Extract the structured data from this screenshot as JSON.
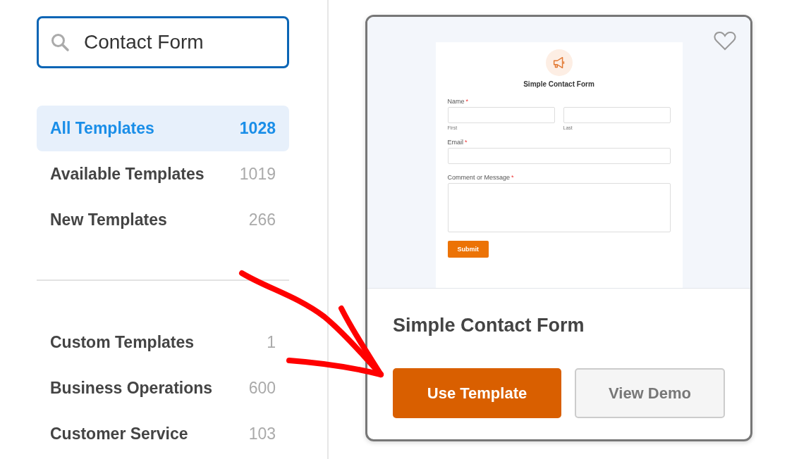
{
  "search": {
    "value": "Contact Form"
  },
  "categories": [
    {
      "label": "All Templates",
      "count": "1028",
      "selected": true
    },
    {
      "label": "Available Templates",
      "count": "1019",
      "selected": false
    },
    {
      "label": "New Templates",
      "count": "266",
      "selected": false
    }
  ],
  "custom_categories": [
    {
      "label": "Custom Templates",
      "count": "1",
      "selected": false
    },
    {
      "label": "Business Operations",
      "count": "600",
      "selected": false
    },
    {
      "label": "Customer Service",
      "count": "103",
      "selected": false
    }
  ],
  "template_card": {
    "preview": {
      "title": "Simple Contact Form",
      "fields": [
        {
          "kind": "name",
          "label": "Name",
          "required_mark": "*",
          "sublabels": [
            "First",
            "Last"
          ]
        },
        {
          "kind": "text",
          "label": "Email",
          "required_mark": "*"
        },
        {
          "kind": "textarea",
          "label": "Comment or Message",
          "required_mark": "*"
        }
      ],
      "submit": "Submit"
    },
    "title": "Simple Contact Form",
    "buttons": [
      {
        "label": "Use Template",
        "kind": "primary"
      },
      {
        "label": "View Demo",
        "kind": "secondary"
      }
    ]
  }
}
